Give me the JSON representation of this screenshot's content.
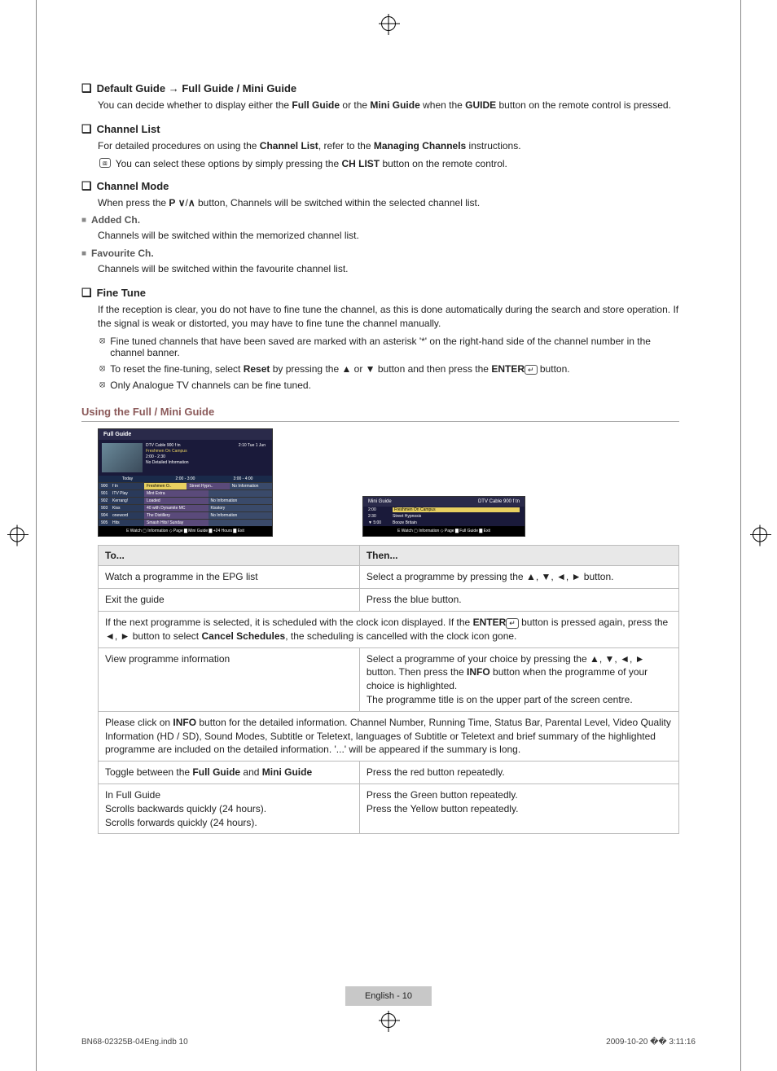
{
  "sections": {
    "defaultGuide": {
      "title_a": "Default Guide",
      "arrow": "→",
      "title_b": "Full Guide / Mini Guide",
      "desc_a": "You can decide whether to display either the ",
      "bold_a": "Full Guide",
      "desc_b": " or the ",
      "bold_b": "Mini Guide",
      "desc_c": " when the ",
      "bold_c": "GUIDE",
      "desc_d": " button on the remote control is pressed."
    },
    "channelList": {
      "title": "Channel List",
      "desc_a": "For detailed procedures on using the ",
      "bold_a": "Channel List",
      "desc_b": ", refer to the ",
      "bold_b": "Managing Channels",
      "desc_c": " instructions.",
      "note": "You can select these options by simply pressing the ",
      "note_bold": "CH LIST",
      "note_end": " button on the remote control."
    },
    "channelMode": {
      "title": "Channel Mode",
      "desc_a": "When press the ",
      "bold_a": "P",
      "desc_b": " button, Channels will be switched within the selected channel list.",
      "added": {
        "title": "Added Ch.",
        "desc": "Channels will be switched within the memorized channel list."
      },
      "fav": {
        "title": "Favourite Ch.",
        "desc": "Channels will be switched within the favourite channel list."
      }
    },
    "fineTune": {
      "title": "Fine Tune",
      "desc": "If the reception is clear, you do not have to fine tune the channel, as this is done automatically during the search and store operation. If the signal is weak or distorted, you may have to fine tune the channel manually.",
      "n1": "Fine tuned channels that have been saved are marked with an asterisk '*' on the right-hand side of the channel number in the channel banner.",
      "n2_a": "To reset the fine-tuning, select ",
      "n2_bold": "Reset",
      "n2_b": " by pressing the ▲ or ▼ button and then press the ",
      "n2_bold2": "ENTER",
      "n2_c": " button.",
      "n3": "Only Analogue TV channels can be fine tuned."
    }
  },
  "guideHeader": "Using the Full / Mini Guide",
  "fullGuideUI": {
    "title": "Full Guide",
    "channel": "DTV Cable 900 f tn",
    "prog": "Freshmen On Campus",
    "time": "2:00 - 2:30",
    "info": "No Detailed Information",
    "date": "2:10 Tue 1 Jun",
    "today": "Today",
    "slot1": "2:00 - 3:00",
    "slot2": "3:00 - 4:00",
    "rows": [
      {
        "num": "900",
        "name": "f tn",
        "p1": "Freshmen O..",
        "p1b": "Street Hypn..",
        "p2": "No Information"
      },
      {
        "num": "901",
        "name": "ITV Play",
        "p1": "Mint Extra",
        "p1b": "",
        "p2": ""
      },
      {
        "num": "902",
        "name": "Kerrang!",
        "p1": "Loaded",
        "p1b": "",
        "p2": "No Information"
      },
      {
        "num": "903",
        "name": "Kiss",
        "p1": "40 with Dynamite MC",
        "p1b": "",
        "p2": "Kisstory"
      },
      {
        "num": "904",
        "name": "oneword",
        "p1": "The Distillery",
        "p1b": "",
        "p2": "No Information"
      },
      {
        "num": "905",
        "name": "Hits",
        "p1": "Smash Hits! Sunday",
        "p1b": "",
        "p2": ""
      }
    ],
    "foot": "E Watch  ▢ Information  ◇ Page  ▇ Mini Guide  ▇ +24 Hours  ▇ Exit"
  },
  "miniGuideUI": {
    "title": "Mini Guide",
    "channel": "DTV Cable 900 f tn",
    "rows": [
      {
        "t": "2:00",
        "p": "Freshmen On Campus"
      },
      {
        "t": "2:30",
        "p": "Street Hypnosis"
      },
      {
        "t": "5:00",
        "p": "Booze Britain"
      }
    ],
    "foot": "E Watch  ▢ Information  ◇ Page  ▇ Full Guide  ▇ Exit"
  },
  "table": {
    "h1": "To...",
    "h2": "Then...",
    "r1a": "Watch a programme in the EPG list",
    "r1b": "Select a programme by pressing the ▲, ▼, ◄, ► button.",
    "r2a": "Exit the guide",
    "r2b": "Press the blue button.",
    "note1_a": "If the next programme is selected, it is scheduled with the clock icon displayed. If the ",
    "note1_bold": "ENTER",
    "note1_b": " button is pressed again, press the ◄, ► button to select ",
    "note1_bold2": "Cancel Schedules",
    "note1_c": ", the scheduling is cancelled with the clock icon gone.",
    "r3a": "View programme information",
    "r3b_a": "Select a programme of your choice by pressing the ▲, ▼, ◄, ► button. Then press the ",
    "r3b_bold": "INFO",
    "r3b_b": " button when the programme of your choice is highlighted.",
    "r3b_c": "The programme title is on the upper part of the screen centre.",
    "note2_a": "Please click on ",
    "note2_bold": "INFO",
    "note2_b": " button for the detailed information. Channel Number, Running Time, Status Bar, Parental Level, Video Quality Information (HD / SD), Sound Modes, Subtitle or Teletext, languages of Subtitle or Teletext and brief summary of the highlighted programme are included on the detailed information. '...' will be appeared if the summary is long.",
    "r4a_a": "Toggle between the ",
    "r4a_bold1": "Full Guide",
    "r4a_mid": " and ",
    "r4a_bold2": "Mini Guide",
    "r4b": "Press the red button repeatedly.",
    "r5a1": "In Full Guide",
    "r5a2": "Scrolls backwards quickly (24 hours).",
    "r5a3": "Scrolls forwards quickly (24 hours).",
    "r5b1": "",
    "r5b2": "Press the Green button repeatedly.",
    "r5b3": "Press the Yellow button repeatedly."
  },
  "pageNum": "English - 10",
  "footer": {
    "left": "BN68-02325B-04Eng.indb   10",
    "right": "2009-10-20   �� 3:11:16"
  }
}
